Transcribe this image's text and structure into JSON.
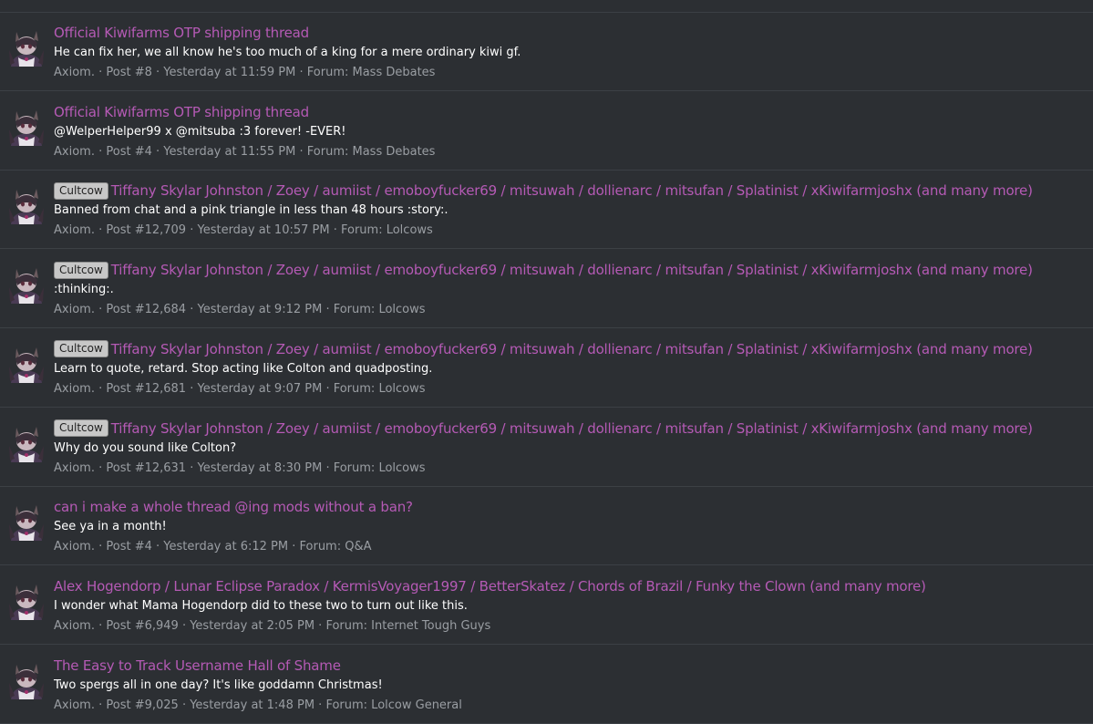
{
  "results": [
    {
      "label": "",
      "title": "Official Kiwifarms OTP shipping thread",
      "snippet": "He can fix her, we all know he's too much of a king for a mere ordinary kiwi gf.",
      "author": "Axiom.",
      "post": "Post #8",
      "time": "Yesterday at 11:59 PM",
      "forum": "Forum: Mass Debates"
    },
    {
      "label": "",
      "title": "Official Kiwifarms OTP shipping thread",
      "snippet": "@WelperHelper99 x @mitsuba :3 forever! -EVER!",
      "author": "Axiom.",
      "post": "Post #4",
      "time": "Yesterday at 11:55 PM",
      "forum": "Forum: Mass Debates"
    },
    {
      "label": "Cultcow",
      "title": "Tiffany Skylar Johnston / Zoey / aumiist / emoboyfucker69 / mitsuwah / dollienarc / mitsufan / Splatinist / xKiwifarmjoshx (and many more)",
      "snippet": "Banned from chat and a pink triangle in less than 48 hours :story:.",
      "author": "Axiom.",
      "post": "Post #12,709",
      "time": "Yesterday at 10:57 PM",
      "forum": "Forum: Lolcows"
    },
    {
      "label": "Cultcow",
      "title": "Tiffany Skylar Johnston / Zoey / aumiist / emoboyfucker69 / mitsuwah / dollienarc / mitsufan / Splatinist / xKiwifarmjoshx (and many more)",
      "snippet": ":thinking:.",
      "author": "Axiom.",
      "post": "Post #12,684",
      "time": "Yesterday at 9:12 PM",
      "forum": "Forum: Lolcows"
    },
    {
      "label": "Cultcow",
      "title": "Tiffany Skylar Johnston / Zoey / aumiist / emoboyfucker69 / mitsuwah / dollienarc / mitsufan / Splatinist / xKiwifarmjoshx (and many more)",
      "snippet": "Learn to quote, retard. Stop acting like Colton and quadposting.",
      "author": "Axiom.",
      "post": "Post #12,681",
      "time": "Yesterday at 9:07 PM",
      "forum": "Forum: Lolcows"
    },
    {
      "label": "Cultcow",
      "title": "Tiffany Skylar Johnston / Zoey / aumiist / emoboyfucker69 / mitsuwah / dollienarc / mitsufan / Splatinist / xKiwifarmjoshx (and many more)",
      "snippet": "Why do you sound like Colton?",
      "author": "Axiom.",
      "post": "Post #12,631",
      "time": "Yesterday at 8:30 PM",
      "forum": "Forum: Lolcows"
    },
    {
      "label": "",
      "title": "can i make a whole thread @ing mods without a ban?",
      "snippet": "See ya in a month!",
      "author": "Axiom.",
      "post": "Post #4",
      "time": "Yesterday at 6:12 PM",
      "forum": "Forum: Q&A"
    },
    {
      "label": "",
      "title": "Alex Hogendorp / Lunar Eclipse Paradox / KermisVoyager1997 / BetterSkatez / Chords of Brazil / Funky the Clown (and many more)",
      "snippet": "I wonder what Mama Hogendorp did to these two to turn out like this.",
      "author": "Axiom.",
      "post": "Post #6,949",
      "time": "Yesterday at 2:05 PM",
      "forum": "Forum: Internet Tough Guys"
    },
    {
      "label": "",
      "title": "The Easy to Track Username Hall of Shame",
      "snippet": "Two spergs all in one day? It's like goddamn Christmas!",
      "author": "Axiom.",
      "post": "Post #9,025",
      "time": "Yesterday at 1:48 PM",
      "forum": "Forum: Lolcow General"
    }
  ],
  "separator": " · ",
  "colors": {
    "background": "#2c2f33",
    "title": "#b55ab5",
    "snippet": "#ffffff",
    "meta": "#9a9ea3",
    "badge_bg": "#c7c7c7",
    "divider": "#3c4045"
  },
  "icons": {
    "avatar": "user-avatar-icon"
  }
}
